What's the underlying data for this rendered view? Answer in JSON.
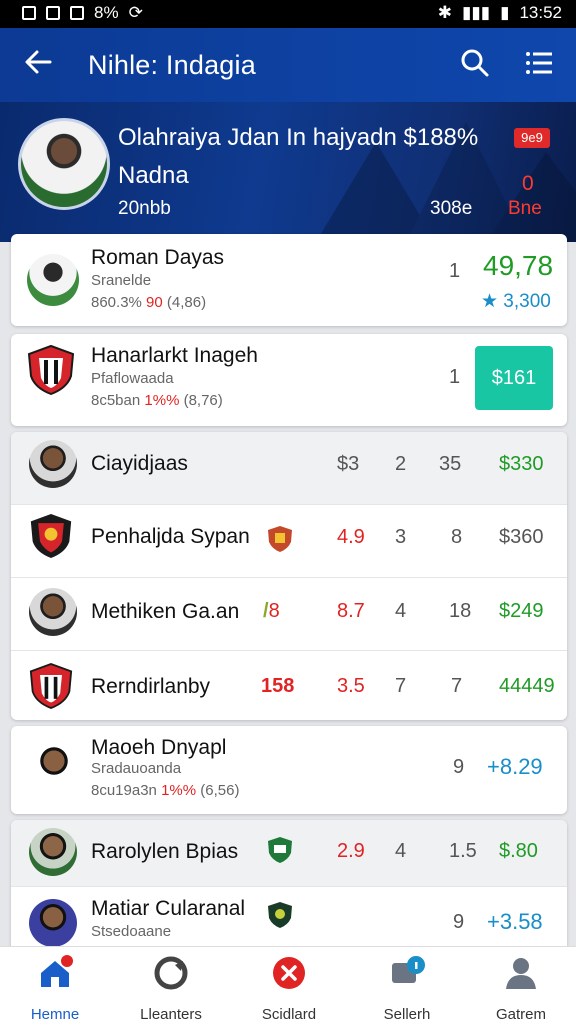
{
  "status_bar": {
    "left_text": "8%",
    "time": "13:52"
  },
  "app_bar": {
    "title": "Nihle: Indagia"
  },
  "hero": {
    "headline": "Olahraiya Jdan In hajyadn $188%",
    "subtitle": "Nadna",
    "meta": "20nbb",
    "stat": "308e",
    "badge": "9e9",
    "red_value": "0",
    "red_label": "Bne"
  },
  "featured": [
    {
      "name": "Roman Dayas",
      "sub": "Sranelde",
      "detail_prefix": "860.3% ",
      "detail_red": "90",
      "detail_suffix": " (4,86)",
      "rank": "1",
      "value": "49,78",
      "change": "★ 3,300"
    },
    {
      "name": "Hanarlarkt Inageh",
      "sub": "Pfaflowaada",
      "detail_prefix": "8c5ban ",
      "detail_red": "1%%",
      "detail_suffix": " (8,76)",
      "rank": "1",
      "button_label": "$161"
    }
  ],
  "table_rows": [
    {
      "name": "Ciayidjaas",
      "col1": "$3",
      "col2": "2",
      "col3": "35",
      "value": "$330"
    },
    {
      "name": "Penhaljda Sypan",
      "col1": "4.9",
      "col2": "3",
      "col3": "8",
      "value": "$360"
    },
    {
      "name": "Methiken Ga.an",
      "badge": "8",
      "col1": "8.7",
      "col2": "4",
      "col3": "18",
      "value": "$249"
    },
    {
      "name": "Rerndirlanby",
      "highlight": "158",
      "col1": "3.5",
      "col2": "7",
      "col3": "7",
      "value": "44449"
    }
  ],
  "single": {
    "name": "Maoeh Dnyapl",
    "sub": "Sradauoanda",
    "detail_prefix": "8cu19a3n ",
    "detail_red": "1%%",
    "detail_suffix": " (6,56)",
    "rank": "9",
    "value": "+8.29"
  },
  "bottom_rows": [
    {
      "name": "Rarolylen Bpias",
      "col1": "2.9",
      "col2": "4",
      "col3": "1.5",
      "value": "$.80"
    },
    {
      "name": "Matiar Cularanal",
      "sub": "Stsedoaane",
      "rank": "9",
      "value": "+3.58"
    }
  ],
  "nav": [
    {
      "label": "Hemne"
    },
    {
      "label": "Lleanters"
    },
    {
      "label": "Scidlard"
    },
    {
      "label": "Sellerh"
    },
    {
      "label": "Gatrem"
    }
  ],
  "colors": {
    "appbar": "#0f47ad",
    "green": "#1f9b26",
    "red": "#e02424",
    "teal": "#19c6a3",
    "blue": "#1a8ec8"
  }
}
